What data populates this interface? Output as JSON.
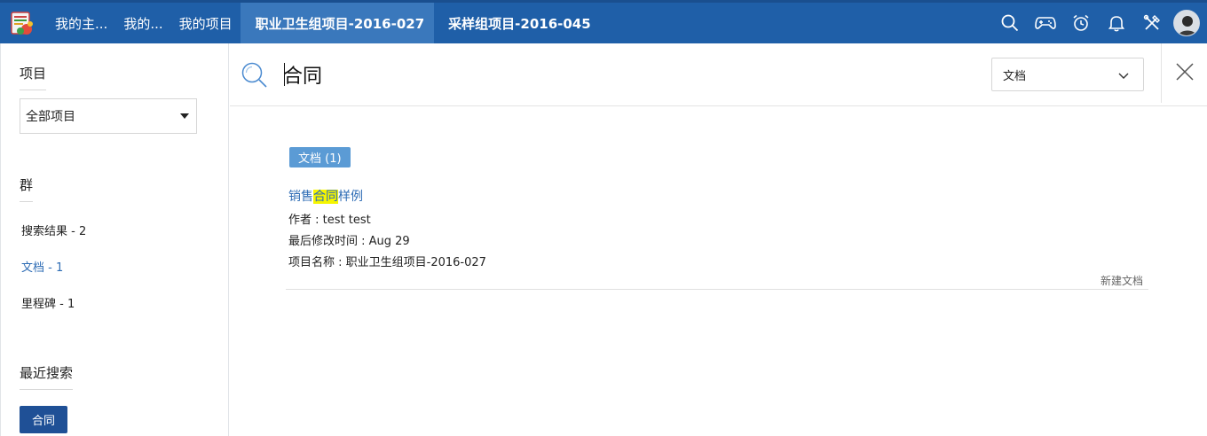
{
  "topbar": {
    "tabs": [
      {
        "label": "我的主..."
      },
      {
        "label": "我的..."
      },
      {
        "label": "我的项目"
      },
      {
        "label": "职业卫生组项目-2016-027",
        "active": true
      },
      {
        "label": "采样组项目-2016-045"
      }
    ],
    "icons": [
      "search-icon",
      "gamepad-icon",
      "alarm-clock-icon",
      "bell-icon",
      "tools-icon",
      "avatar"
    ],
    "bg_color": "#1f5fa8",
    "active_tab_color": "#3a78bc"
  },
  "sidebar": {
    "project_title": "项目",
    "project_select": "全部项目",
    "group_title": "群",
    "groups": [
      {
        "label": "搜索结果 -  2"
      },
      {
        "label": "文档 -  1",
        "active": true
      },
      {
        "label": "里程碑 -  1"
      }
    ],
    "recent_title": "最近搜索",
    "recent_items": [
      "合同"
    ]
  },
  "search": {
    "query": "合同",
    "type_select": "文档"
  },
  "results": {
    "badge": "文档 (1)",
    "item": {
      "title_prefix": "销售",
      "title_highlight": "合同",
      "title_suffix": "样例",
      "author": "作者 : test test",
      "modified": "最后修改时间 : Aug 29",
      "project": "项目名称 : 职业卫生组项目-2016-027",
      "new_doc": "新建文档"
    }
  }
}
